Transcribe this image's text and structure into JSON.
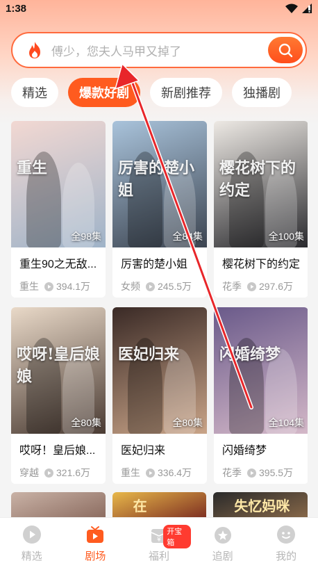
{
  "status_bar": {
    "time": "1:38"
  },
  "search": {
    "placeholder": "傅少，您夫人马甲又掉了"
  },
  "tabs": [
    {
      "label": "精选",
      "active": false
    },
    {
      "label": "爆款好剧",
      "active": true
    },
    {
      "label": "新剧推荐",
      "active": false
    },
    {
      "label": "独播剧",
      "active": false
    }
  ],
  "cards": [
    {
      "title": "重生90之无敌...",
      "genre": "重生",
      "views": "394.1万",
      "episodes": "全98集",
      "poster_text": "重生",
      "poster_colors": [
        "#f2d8d2",
        "#9fb3c8"
      ]
    },
    {
      "title": "厉害的楚小姐",
      "genre": "女频",
      "views": "245.5万",
      "episodes": "全84集",
      "poster_text": "厉害的楚小姐",
      "poster_colors": [
        "#a9c3db",
        "#3c4450"
      ]
    },
    {
      "title": "樱花树下的约定",
      "genre": "花季",
      "views": "297.6万",
      "episodes": "全100集",
      "poster_text": "樱花树下的约定",
      "poster_colors": [
        "#ede9e4",
        "#2a2a2e"
      ]
    },
    {
      "title": "哎呀！皇后娘...",
      "genre": "穿越",
      "views": "321.6万",
      "episodes": "全80集",
      "poster_text": "哎呀!皇后娘娘",
      "poster_colors": [
        "#e9d9c8",
        "#4a3b33"
      ]
    },
    {
      "title": "医妃归来",
      "genre": "重生",
      "views": "336.4万",
      "episodes": "全80集",
      "poster_text": "医妃归来",
      "poster_colors": [
        "#3a2a26",
        "#c9a488"
      ]
    },
    {
      "title": "闪婚绮梦",
      "genre": "花季",
      "views": "395.5万",
      "episodes": "全104集",
      "poster_text": "闪婚绮梦",
      "poster_colors": [
        "#6a5a8a",
        "#d4b8c8"
      ]
    }
  ],
  "partial_row": [
    {
      "poster_colors": [
        "#c9b2a6",
        "#8a6a5e"
      ],
      "poster_text": ""
    },
    {
      "poster_colors": [
        "#e8b84a",
        "#7a2a20"
      ],
      "poster_text": "在"
    },
    {
      "poster_colors": [
        "#2a2a2a",
        "#8a6a4a"
      ],
      "poster_text": "失忆妈咪"
    }
  ],
  "bottom_nav": [
    {
      "label": "精选",
      "icon": "play-circle-icon",
      "active": false
    },
    {
      "label": "剧场",
      "icon": "tv-icon",
      "active": true
    },
    {
      "label": "福利",
      "icon": "gift-icon",
      "active": false,
      "badge": "开宝箱"
    },
    {
      "label": "追剧",
      "icon": "star-icon",
      "active": false
    },
    {
      "label": "我的",
      "icon": "face-icon",
      "active": false
    }
  ],
  "colors": {
    "accent": "#ff5b1f",
    "annotation_arrow": "#e8262a"
  }
}
